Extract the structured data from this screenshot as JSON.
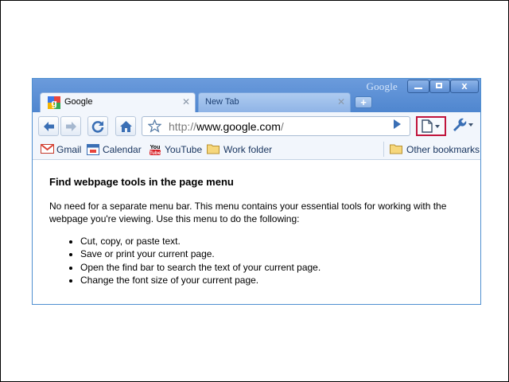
{
  "window": {
    "brand": "Google",
    "controls": {
      "minimize": "minimize",
      "maximize": "maximize",
      "close": "x"
    }
  },
  "tabs": [
    {
      "label": "Google",
      "active": true
    },
    {
      "label": "New Tab",
      "active": false
    }
  ],
  "toolbar": {
    "url_scheme": "http://",
    "url_host": "www.google.com",
    "url_tail": "/"
  },
  "bookmarks": {
    "items": [
      {
        "label": "Gmail"
      },
      {
        "label": "Calendar"
      },
      {
        "label": "YouTube"
      },
      {
        "label": "Work folder"
      }
    ],
    "other": "Other bookmarks"
  },
  "content": {
    "heading": "Find webpage tools in the page menu",
    "paragraph": "No need for a separate menu bar. This menu contains your essential tools for working with the webpage you're viewing. Use this menu to do the following:",
    "list": [
      "Cut, copy, or paste text.",
      "Save or print your current page.",
      "Open the find bar to search the text of your current page.",
      "Change the font size of your current page."
    ]
  },
  "colors": {
    "frame": "#4f86cf",
    "highlight": "#c0143c",
    "toolbar": "#f2f6fc"
  }
}
